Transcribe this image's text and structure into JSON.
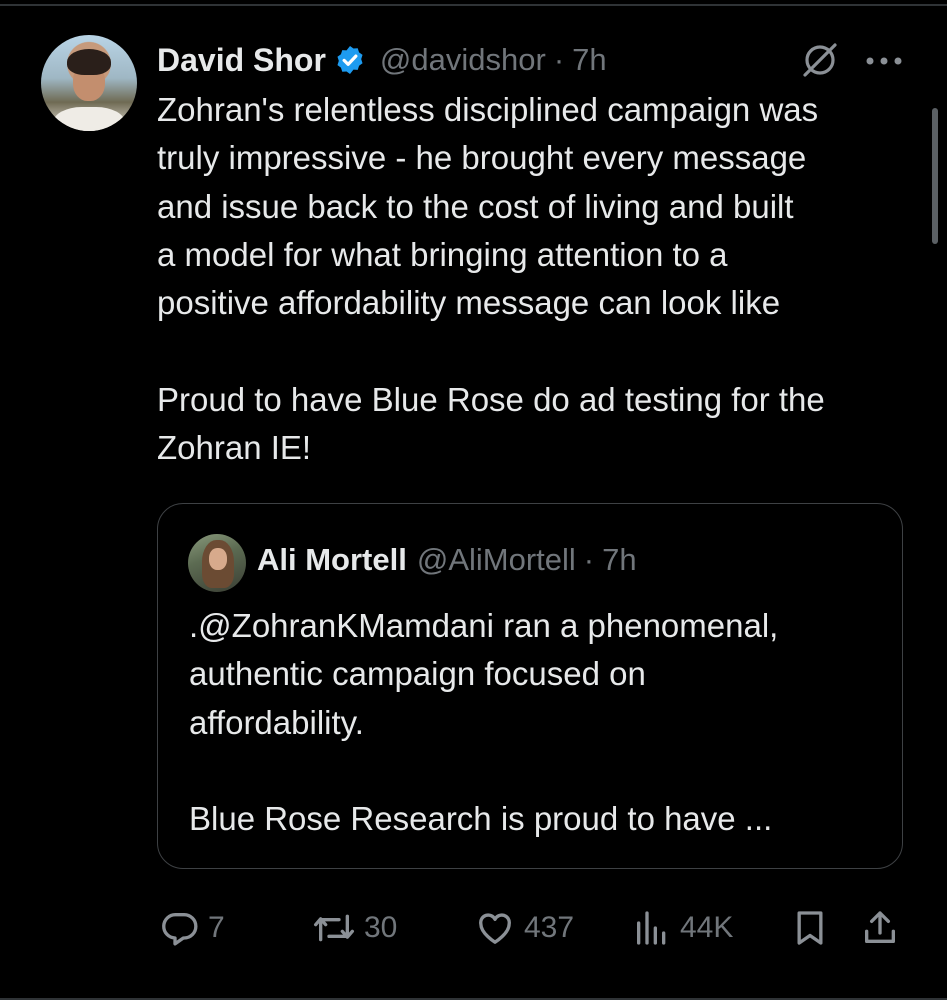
{
  "author": {
    "name": "David Shor",
    "handle": "@davidshor",
    "time": "7h"
  },
  "tweet_text": "Zohran's relentless disciplined campaign was\ntruly impressive - he brought every message\nand issue back to the cost of living and built\na model for what bringing attention to a\npositive affordability message can look like\n\nProud to have Blue Rose do ad testing for the\nZohran IE!",
  "quote": {
    "name": "Ali Mortell",
    "handle": "@AliMortell",
    "time": "7h",
    "text": ".@ZohranKMamdani ran a phenomenal,\nauthentic campaign focused on\naffordability.\n\nBlue Rose Research is proud to have ..."
  },
  "metrics": {
    "replies": "7",
    "reposts": "30",
    "likes": "437",
    "views": "44K"
  },
  "icons": [
    "verified-badge-icon",
    "grok-icon",
    "more-icon",
    "reply-icon",
    "repost-icon",
    "like-icon",
    "views-icon",
    "bookmark-icon",
    "share-icon"
  ],
  "colors": {
    "background": "#000000",
    "text": "#e7e9ea",
    "secondary": "#71767b",
    "verified": "#1d9bf0",
    "border": "#3e4144"
  }
}
